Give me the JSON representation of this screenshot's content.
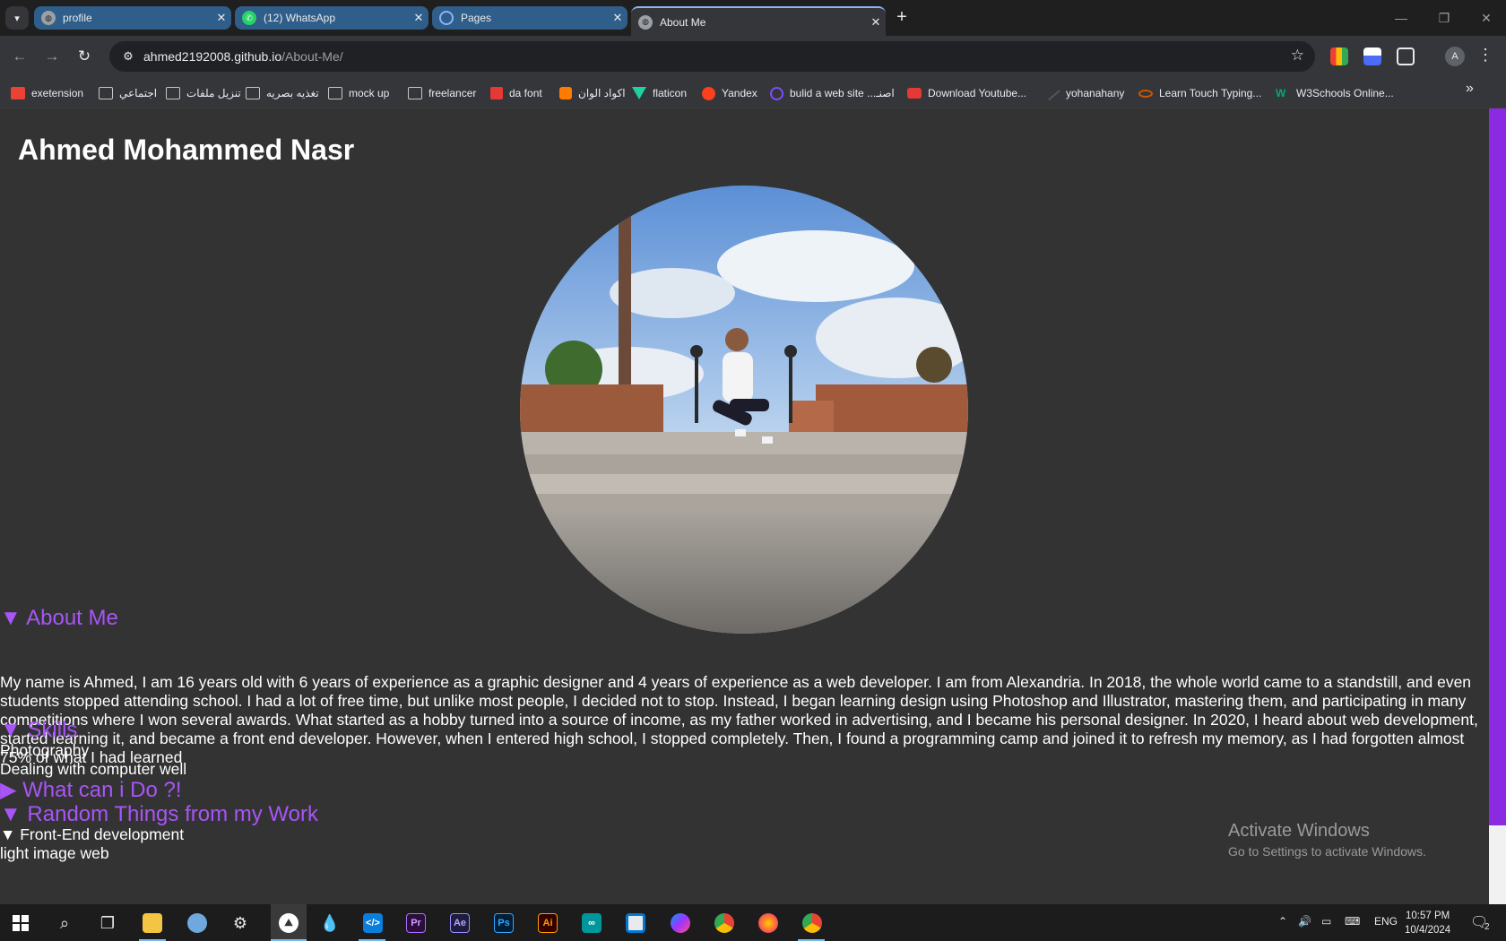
{
  "browser": {
    "tabs": [
      {
        "title": "profile",
        "icon": "globe-icon"
      },
      {
        "title": "(12) WhatsApp",
        "icon": "whatsapp-icon"
      },
      {
        "title": "Pages",
        "icon": "spinner-icon"
      },
      {
        "title": "About Me",
        "icon": "globe-icon",
        "active": true
      }
    ],
    "url_host": "ahmed2192008.github.io",
    "url_path": "/About-Me/",
    "bookmarks": [
      {
        "label": "exetension",
        "icon": "extension-icon"
      },
      {
        "label": "اجتماعي",
        "icon": "folder-icon"
      },
      {
        "label": "تنزيل ملفات",
        "icon": "folder-icon"
      },
      {
        "label": "تغذيه بصريه",
        "icon": "folder-icon"
      },
      {
        "label": "mock up",
        "icon": "folder-icon"
      },
      {
        "label": "freelancer",
        "icon": "folder-icon"
      },
      {
        "label": "da font",
        "icon": "dafont-icon"
      },
      {
        "label": "اكواد الوان",
        "icon": "blogger-icon"
      },
      {
        "label": "flaticon",
        "icon": "flaticon-icon"
      },
      {
        "label": "Yandex",
        "icon": "yandex-icon"
      },
      {
        "label": "bulid a web site ...اصنـ",
        "icon": "ring-icon"
      },
      {
        "label": "Download Youtube...",
        "icon": "youtube-download-icon"
      },
      {
        "label": "yohanahany",
        "icon": "pen-icon"
      },
      {
        "label": "Learn Touch Typing...",
        "icon": "typing-icon"
      },
      {
        "label": "W3Schools Online...",
        "icon": "w3schools-icon"
      }
    ],
    "profile_initial": "A"
  },
  "page": {
    "name": "Ahmed Mohammed Nasr",
    "about_heading": "About Me",
    "about_text": "My name is Ahmed, I am 16 years old with 6 years of experience as a graphic designer and 4 years of experience as a web developer. I am from Alexandria. In 2018, the whole world came to a standstill, and even students stopped attending school. I had a lot of free time, but unlike most people, I decided not to stop. Instead, I began learning design using Photoshop and Illustrator, mastering them, and participating in many competitions where I won several awards. What started as a hobby turned into a source of income, as my father worked in advertising, and I became his personal designer. In 2020, I heard about web development, started learning it, and became a front end developer. However, when I entered high school, I stopped completely. Then, I found a programming camp and joined it to refresh my memory, as I had forgotten almost 75% of what I had learned",
    "skills_heading": "Skills",
    "skills": [
      "Photography",
      "Dealing with computer well"
    ],
    "whatcan_heading": "What can i Do ?!",
    "random_heading": "Random Things from my Work",
    "frontend_label": "Front-End development",
    "cut_text": "light image web"
  },
  "watermark": {
    "line1": "Activate Windows",
    "line2": "Go to Settings to activate Windows."
  },
  "taskbar": {
    "language": "ENG",
    "time": "10:57 PM",
    "date": "10/4/2024",
    "notifications": "2"
  },
  "colors": {
    "accent_purple": "#a855f7",
    "page_bg": "#333333",
    "scroll_thumb": "#8a2be2"
  }
}
